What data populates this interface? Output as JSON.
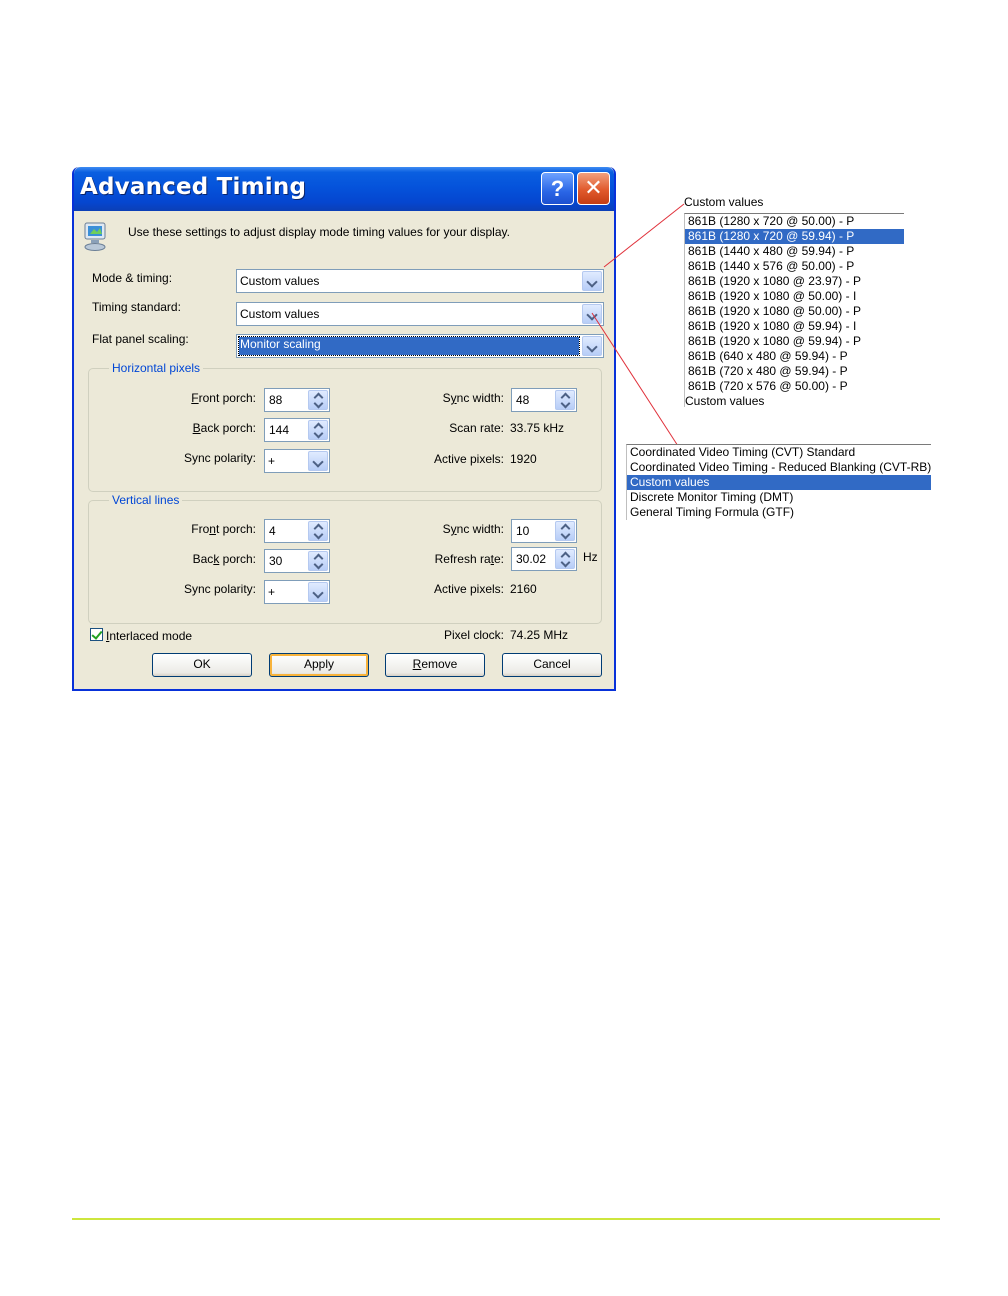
{
  "dialog": {
    "title": "Advanced Timing",
    "help_glyph": "?",
    "close_glyph": "✕",
    "description": "Use these settings to adjust display mode timing values for your display.",
    "mode_timing": {
      "label": "Mode & timing:",
      "value": "Custom values"
    },
    "timing_standard": {
      "label": "Timing standard:",
      "value": "Custom values"
    },
    "flat_panel_scaling": {
      "label": "Flat panel scaling:",
      "value": "Monitor scaling"
    },
    "horizontal": {
      "title": "Horizontal pixels",
      "front_porch": {
        "label_pre": "",
        "label_key": "F",
        "label_post": "ront porch:",
        "value": "88"
      },
      "back_porch": {
        "label_pre": "",
        "label_key": "B",
        "label_post": "ack porch:",
        "value": "144"
      },
      "sync_polarity": {
        "label": "Sync polarity:",
        "value": "+"
      },
      "sync_width": {
        "label_pre": "S",
        "label_key": "y",
        "label_post": "nc width:",
        "value": "48"
      },
      "scan_rate": {
        "label": "Scan rate:",
        "value": "33.75 kHz"
      },
      "active_pixels": {
        "label": "Active pixels:",
        "value": "1920"
      }
    },
    "vertical": {
      "title": "Vertical lines",
      "front_porch": {
        "label_pre": "Fro",
        "label_key": "n",
        "label_post": "t porch:",
        "value": "4"
      },
      "back_porch": {
        "label_pre": "Bac",
        "label_key": "k",
        "label_post": " porch:",
        "value": "30"
      },
      "sync_polarity": {
        "label": "Sync polarity:",
        "value": "+"
      },
      "sync_width": {
        "label_pre": "S",
        "label_key": "y",
        "label_post": "nc width:",
        "value": "10"
      },
      "refresh_rate": {
        "label_pre": "Refresh ra",
        "label_key": "t",
        "label_post": "e:",
        "value": "30.02",
        "unit": "Hz"
      },
      "active_pixels": {
        "label": "Active pixels:",
        "value": "2160"
      }
    },
    "interlaced": {
      "label_key": "I",
      "label_post": "nterlaced mode",
      "checked": true
    },
    "pixel_clock": {
      "label": "Pixel clock:",
      "value": "74.25 MHz"
    },
    "buttons": {
      "ok": "OK",
      "apply": "Apply",
      "remove_key": "R",
      "remove_post": "emove",
      "cancel": "Cancel"
    }
  },
  "mode_list": {
    "header": "Custom values",
    "items": [
      "861B  (1280 x 720 @ 50.00) - P",
      "861B  (1280 x 720 @ 59.94) - P",
      "861B  (1440 x 480 @ 59.94) - P",
      "861B  (1440 x 576 @ 50.00) - P",
      "861B  (1920 x 1080 @ 23.97) - P",
      "861B  (1920 x 1080 @ 50.00) - I",
      "861B  (1920 x 1080 @ 50.00) - P",
      "861B  (1920 x 1080 @ 59.94) - I",
      "861B  (1920 x 1080 @ 59.94) - P",
      "861B  (640 x 480 @ 59.94) - P",
      "861B  (720 x 480 @ 59.94) - P",
      "861B  (720 x 576 @ 50.00) - P",
      "Custom values"
    ],
    "selected_index": 1
  },
  "timing_list": {
    "items": [
      "Coordinated Video Timing (CVT) Standard",
      "Coordinated Video Timing - Reduced Blanking (CVT-RB)",
      "Custom values",
      "Discrete Monitor Timing (DMT)",
      "General Timing Formula (GTF)"
    ],
    "selected_index": 2
  },
  "colors": {
    "callout_line": "#e0303a",
    "selection": "#316ac5",
    "footer_rule": "#cde63e"
  }
}
